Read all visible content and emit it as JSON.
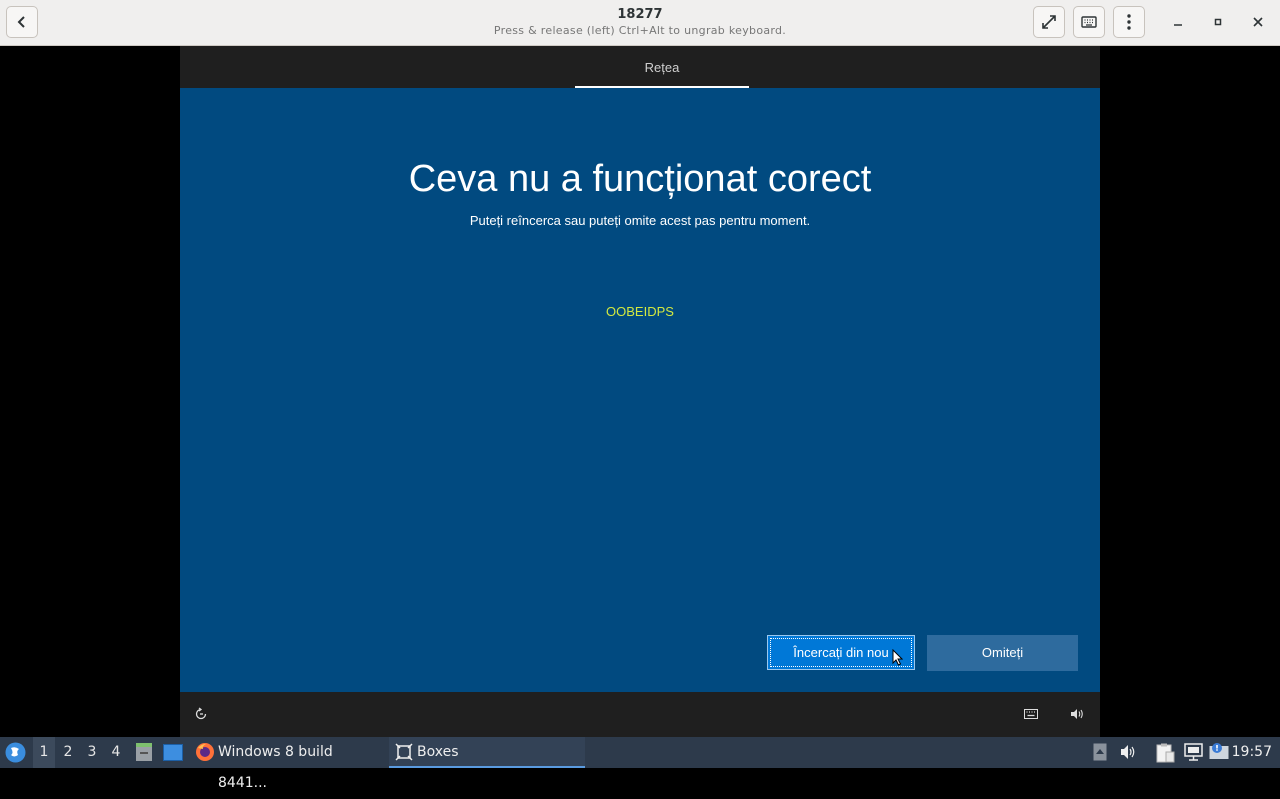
{
  "header": {
    "title": "18277",
    "subtitle": "Press & release (left) Ctrl+Alt to ungrab keyboard."
  },
  "vm": {
    "tab_label": "Rețea",
    "heading": "Ceva nu a funcționat corect",
    "subheading": "Puteți reîncerca sau puteți omite acest pas pentru moment.",
    "error_code": "OOBEIDPS",
    "retry_label": "Încercați din nou",
    "skip_label": "Omiteți"
  },
  "taskbar": {
    "workspaces": [
      "1",
      "2",
      "3",
      "4"
    ],
    "firefox_task": "Windows 8 build 8441...",
    "boxes_task": "Boxes",
    "clock": "19:57"
  },
  "colors": {
    "vm_background": "#014a80",
    "primary_button": "#0078d7",
    "secondary_button": "#2e6b9e",
    "error_code": "#d2e840",
    "taskbar": "#2d3a4b"
  }
}
